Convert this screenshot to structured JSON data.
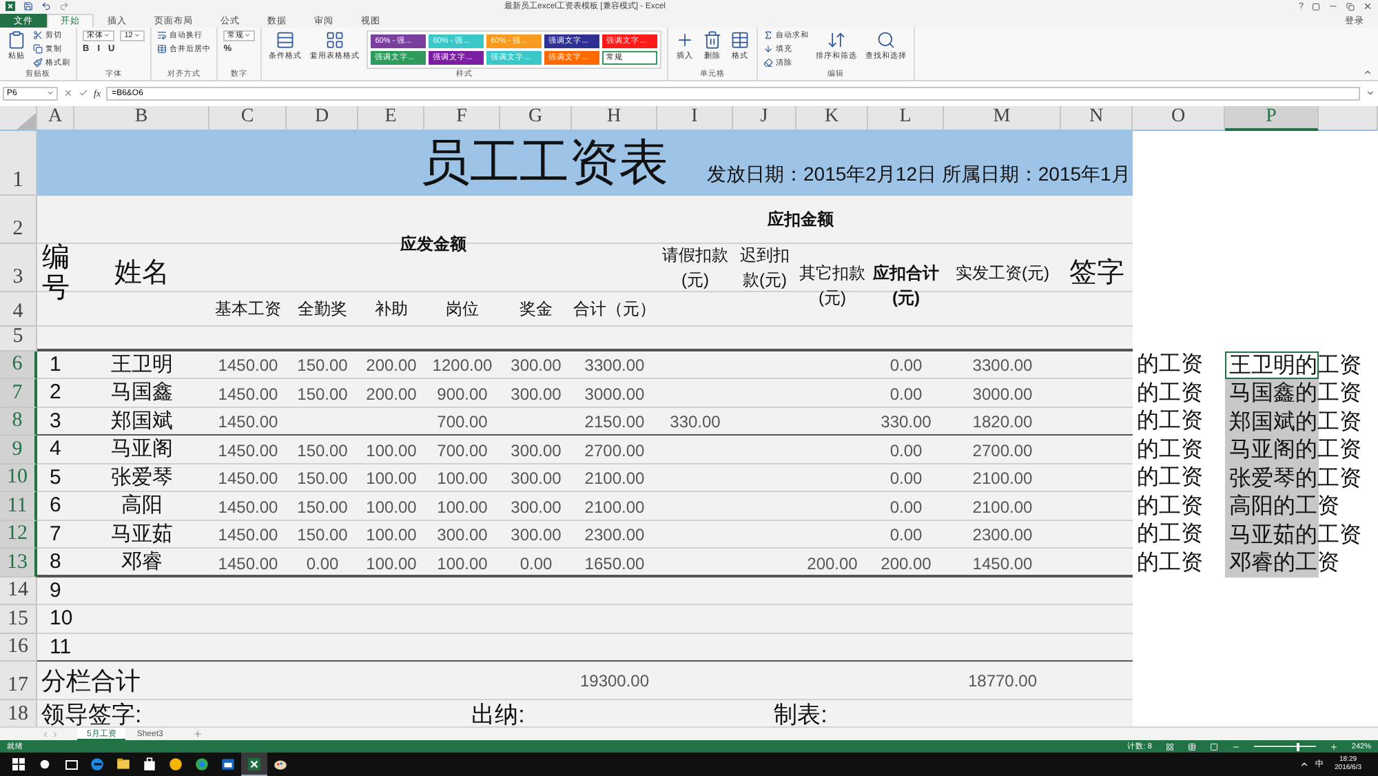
{
  "window": {
    "title": "最新员工excel工资表模板 [兼容模式] - Excel",
    "help": "?",
    "sign_in": "登录"
  },
  "ribbon_tabs": [
    {
      "label": "文件",
      "kind": "file",
      "selected": false
    },
    {
      "label": "开始",
      "kind": "tab",
      "selected": true
    },
    {
      "label": "插入",
      "kind": "tab",
      "selected": false
    },
    {
      "label": "页面布局",
      "kind": "tab",
      "selected": false
    },
    {
      "label": "公式",
      "kind": "tab",
      "selected": false
    },
    {
      "label": "数据",
      "kind": "tab",
      "selected": false
    },
    {
      "label": "审阅",
      "kind": "tab",
      "selected": false
    },
    {
      "label": "视图",
      "kind": "tab",
      "selected": false
    }
  ],
  "ribbon_groups": [
    {
      "label": "剪贴板",
      "columns": [
        [
          {
            "kind": "big",
            "text": "粘贴"
          }
        ],
        [
          {
            "kind": "small",
            "text": "剪切"
          },
          {
            "kind": "small",
            "text": "复制"
          },
          {
            "kind": "small",
            "text": "格式刷"
          }
        ]
      ]
    },
    {
      "label": "字体",
      "columns": [
        [
          {
            "kind": "field",
            "text": "宋体"
          },
          {
            "kind": "glyphs",
            "glyphs": [
              "B",
              "I",
              "U"
            ]
          }
        ],
        [
          {
            "kind": "field",
            "text": "12"
          }
        ]
      ]
    },
    {
      "label": "对齐方式",
      "columns": [
        [
          {
            "kind": "small",
            "text": "自动换行"
          },
          {
            "kind": "small",
            "text": "合并后居中"
          }
        ]
      ]
    },
    {
      "label": "数字",
      "columns": [
        [
          {
            "kind": "field",
            "text": "常规"
          },
          {
            "kind": "glyphs",
            "glyphs": [
              "%"
            ]
          }
        ]
      ]
    },
    {
      "label": "样式",
      "columns": [
        [
          {
            "kind": "big",
            "text": "条件格式"
          }
        ],
        [
          {
            "kind": "big",
            "text": "套用表格格式"
          }
        ],
        [
          {
            "kind": "gallery",
            "styles": [
              {
                "text": "60% - 强...",
                "color": "#7b3f9e"
              },
              {
                "text": "60% - 强...",
                "color": "#3cc8c8"
              },
              {
                "text": "60% - 强...",
                "color": "#f79a1e"
              },
              {
                "text": "强调文字...",
                "color": "#2e3192"
              },
              {
                "text": "强调文字...",
                "color": "#ff1a1a"
              },
              {
                "text": "强调文字...",
                "color": "#2e9a5c"
              },
              {
                "text": "强调文字...",
                "color": "#7b1fa2"
              },
              {
                "text": "强调文字...",
                "color": "#3cc8c8"
              },
              {
                "text": "强调文字...",
                "color": "#ff6a00"
              },
              {
                "text": "常规",
                "color": "#ffffff"
              }
            ]
          }
        ]
      ]
    },
    {
      "label": "单元格",
      "columns": [
        [
          {
            "kind": "big",
            "text": "插入"
          }
        ],
        [
          {
            "kind": "big",
            "text": "删除"
          }
        ],
        [
          {
            "kind": "big",
            "text": "格式"
          }
        ]
      ]
    },
    {
      "label": "编辑",
      "columns": [
        [
          {
            "kind": "small",
            "text": "自动求和"
          },
          {
            "kind": "small",
            "text": "填充"
          },
          {
            "kind": "small",
            "text": "清除"
          }
        ],
        [
          {
            "kind": "big",
            "text": "排序和筛选"
          }
        ],
        [
          {
            "kind": "big",
            "text": "查找和选择"
          }
        ]
      ]
    }
  ],
  "formula_bar": {
    "name_box": "P6",
    "fx": "fx",
    "formula": "=B6&O6"
  },
  "column_headers": [
    {
      "label": "A",
      "selected": false
    },
    {
      "label": "B",
      "selected": false
    },
    {
      "label": "C",
      "selected": false
    },
    {
      "label": "D",
      "selected": false
    },
    {
      "label": "E",
      "selected": false
    },
    {
      "label": "F",
      "selected": false
    },
    {
      "label": "G",
      "selected": false
    },
    {
      "label": "H",
      "selected": false
    },
    {
      "label": "I",
      "selected": false
    },
    {
      "label": "J",
      "selected": false
    },
    {
      "label": "K",
      "selected": false
    },
    {
      "label": "L",
      "selected": false
    },
    {
      "label": "M",
      "selected": false
    },
    {
      "label": "N",
      "selected": false
    },
    {
      "label": "O",
      "selected": false
    },
    {
      "label": "P",
      "selected": true
    }
  ],
  "row_headers": [
    {
      "label": "1",
      "selected": false
    },
    {
      "label": "2",
      "selected": false
    },
    {
      "label": "3",
      "selected": false
    },
    {
      "label": "4",
      "selected": false
    },
    {
      "label": "5",
      "selected": false
    },
    {
      "label": "6",
      "selected": true
    },
    {
      "label": "7",
      "selected": true
    },
    {
      "label": "8",
      "selected": true
    },
    {
      "label": "9",
      "selected": true
    },
    {
      "label": "10",
      "selected": true
    },
    {
      "label": "11",
      "selected": true
    },
    {
      "label": "12",
      "selected": true
    },
    {
      "label": "13",
      "selected": true
    },
    {
      "label": "14",
      "selected": false
    },
    {
      "label": "15",
      "selected": false
    },
    {
      "label": "16",
      "selected": false
    },
    {
      "label": "17",
      "selected": false
    },
    {
      "label": "18",
      "selected": false
    }
  ],
  "title_banner": {
    "title": "员工工资表",
    "dates": "发放日期：2015年2月12日 所属日期：2015年1月"
  },
  "header": {
    "number": "编号",
    "name": "姓名",
    "payable": "应发金额",
    "payable_columns": [
      "基本工资",
      "全勤奖",
      "补助",
      "岗位",
      "奖金",
      "合计（元）"
    ],
    "deductions": "应扣金额",
    "leave": "请假扣款(元)",
    "late": "迟到扣款(元)",
    "other": "其它扣款(元)",
    "deduction_total": "应扣合计(元)",
    "net_pay": "实发工资(元)",
    "signature": "签字"
  },
  "employees": [
    {
      "number": "1",
      "name": "王卫明",
      "base_salary": "1450.00",
      "attendance_bonus": "150.00",
      "subsidy": "200.00",
      "position_pay": "1200.00",
      "bonus": "300.00",
      "total": "3300.00",
      "deduction_total": "0.00",
      "net_pay": "3300.00",
      "o_text": "的工资",
      "p_cell": {
        "text": "王卫明的工资",
        "selected": true,
        "active": true
      }
    },
    {
      "number": "2",
      "name": "马国鑫",
      "base_salary": "1450.00",
      "attendance_bonus": "150.00",
      "subsidy": "200.00",
      "position_pay": "900.00",
      "bonus": "300.00",
      "total": "3000.00",
      "deduction_total": "0.00",
      "net_pay": "3000.00",
      "o_text": "的工资",
      "p_cell": {
        "text": "马国鑫的工资",
        "selected": true,
        "active": false
      }
    },
    {
      "number": "3",
      "name": "郑国斌",
      "base_salary": "1450.00",
      "position_pay": "700.00",
      "total": "2150.00",
      "leave_deduction": "330.00",
      "deduction_total": "330.00",
      "net_pay": "1820.00",
      "o_text": "的工资",
      "p_cell": {
        "text": "郑国斌的工资",
        "selected": true,
        "active": false
      }
    },
    {
      "number": "4",
      "name": "马亚阁",
      "base_salary": "1450.00",
      "attendance_bonus": "150.00",
      "subsidy": "100.00",
      "position_pay": "700.00",
      "bonus": "300.00",
      "total": "2700.00",
      "deduction_total": "0.00",
      "net_pay": "2700.00",
      "o_text": "的工资",
      "p_cell": {
        "text": "马亚阁的工资",
        "selected": true,
        "active": false
      }
    },
    {
      "number": "5",
      "name": "张爱琴",
      "base_salary": "1450.00",
      "attendance_bonus": "150.00",
      "subsidy": "100.00",
      "position_pay": "100.00",
      "bonus": "300.00",
      "total": "2100.00",
      "deduction_total": "0.00",
      "net_pay": "2100.00",
      "o_text": "的工资",
      "p_cell": {
        "text": "张爱琴的工资",
        "selected": true,
        "active": false
      }
    },
    {
      "number": "6",
      "name": "高阳",
      "base_salary": "1450.00",
      "attendance_bonus": "150.00",
      "subsidy": "100.00",
      "position_pay": "100.00",
      "bonus": "300.00",
      "total": "2100.00",
      "deduction_total": "0.00",
      "net_pay": "2100.00",
      "o_text": "的工资",
      "p_cell": {
        "text": "高阳的工资",
        "selected": true,
        "active": false
      }
    },
    {
      "number": "7",
      "name": "马亚茹",
      "base_salary": "1450.00",
      "attendance_bonus": "150.00",
      "subsidy": "100.00",
      "position_pay": "300.00",
      "bonus": "300.00",
      "total": "2300.00",
      "deduction_total": "0.00",
      "net_pay": "2300.00",
      "o_text": "的工资",
      "p_cell": {
        "text": "马亚茹的工资",
        "selected": true,
        "active": false
      }
    },
    {
      "number": "8",
      "name": "邓睿",
      "base_salary": "1450.00",
      "attendance_bonus": "0.00",
      "subsidy": "100.00",
      "position_pay": "100.00",
      "bonus": "0.00",
      "total": "1650.00",
      "other_deduction": "200.00",
      "deduction_total": "200.00",
      "net_pay": "1450.00",
      "o_text": "的工资",
      "p_cell": {
        "text": "邓睿的工资",
        "selected": true,
        "active": false
      }
    }
  ],
  "blank_rows": [
    {
      "number": "9"
    },
    {
      "number": "10"
    },
    {
      "number": "11"
    }
  ],
  "totals": {
    "label": "分栏合计",
    "total": "19300.00",
    "net_pay": "18770.00"
  },
  "signatures": {
    "leader": "领导签字:",
    "cashier": "出纳:",
    "preparer": "制表:"
  },
  "sheet_tabs": [
    {
      "label": "5月工资",
      "selected": true
    },
    {
      "label": "Sheet3",
      "selected": false
    }
  ],
  "status_bar": {
    "ready": "就绪",
    "count": "计数: 8",
    "zoom": {
      "level": 0.69,
      "reading": "242%"
    }
  },
  "taskbar": {
    "apps": [
      {
        "active": false
      },
      {
        "active": false
      },
      {
        "active": false
      },
      {
        "active": false
      },
      {
        "active": false
      },
      {
        "active": false
      },
      {
        "active": true
      },
      {
        "active": false
      }
    ],
    "ime": "中",
    "time": "18:29",
    "date": "2016/6/3"
  }
}
